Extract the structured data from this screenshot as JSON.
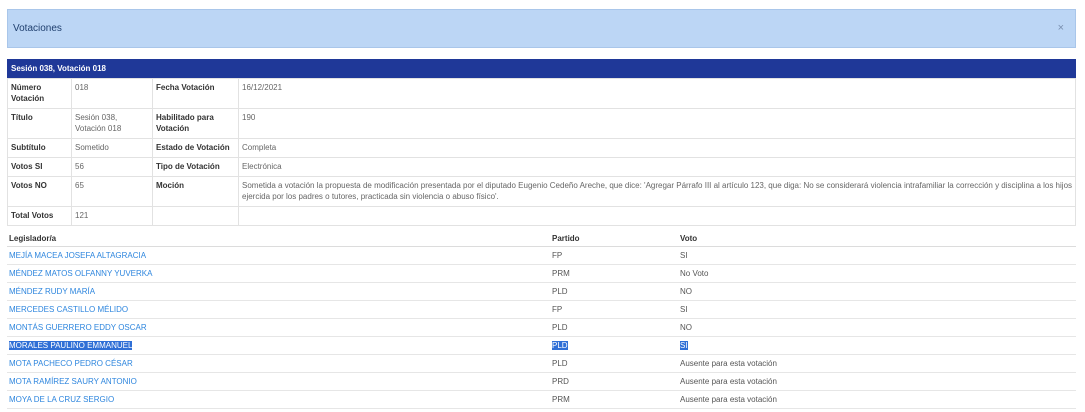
{
  "dialog": {
    "title": "Votaciones",
    "close": "×"
  },
  "session_header": "Sesión 038, Votación 018",
  "info": {
    "numero_label": "Número Votación",
    "numero_value": "018",
    "fecha_label": "Fecha Votación",
    "fecha_value": "16/12/2021",
    "titulo_label": "Título",
    "titulo_value": "Sesión 038, Votación 018",
    "habilitado_label": "Habilitado para Votación",
    "habilitado_value": "190",
    "subtitulo_label": "Subtítulo",
    "subtitulo_value": "Sometido",
    "estado_label": "Estado de Votación",
    "estado_value": "Completa",
    "si_label": "Votos SI",
    "si_value": "56",
    "tipo_label": "Tipo de Votación",
    "tipo_value": "Electrónica",
    "no_label": "Votos NO",
    "no_value": "65",
    "mocion_label": "Moción",
    "mocion_value": "Sometida a votación la propuesta de modificación presentada por el diputado Eugenio Cedeño Areche, que dice: 'Agregar Párrafo III al artículo 123, que diga: No se considerará violencia intrafamiliar la corrección y disciplina a los hijos ejercida por los padres o tutores, practicada sin violencia o abuso físico'.",
    "total_label": "Total Votos",
    "total_value": "121"
  },
  "votes": {
    "headers": {
      "legislador": "Legislador/a",
      "partido": "Partido",
      "voto": "Voto"
    },
    "rows": [
      {
        "name": "MEJÍA MACEA JOSEFA ALTAGRACIA",
        "party": "FP",
        "vote": "SI"
      },
      {
        "name": "MÉNDEZ MATOS OLFANNY YUVERKA",
        "party": "PRM",
        "vote": "No Voto"
      },
      {
        "name": "MÉNDEZ RUDY MARÍA",
        "party": "PLD",
        "vote": "NO"
      },
      {
        "name": "MERCEDES CASTILLO MÉLIDO",
        "party": "FP",
        "vote": "SI"
      },
      {
        "name": "MONTÁS GUERRERO EDDY OSCAR",
        "party": "PLD",
        "vote": "NO"
      },
      {
        "name": "MORALES PAULINO EMMANUEL",
        "party": "PLD",
        "vote": "SI"
      },
      {
        "name": "MOTA PACHECO PEDRO CÉSAR",
        "party": "PLD",
        "vote": "Ausente para esta votación"
      },
      {
        "name": "MOTA RAMÍREZ SAURY ANTONIO",
        "party": "PRD",
        "vote": "Ausente para esta votación"
      },
      {
        "name": "MOYA DE LA CRUZ SERGIO",
        "party": "PRM",
        "vote": "Ausente para esta votación"
      }
    ]
  }
}
